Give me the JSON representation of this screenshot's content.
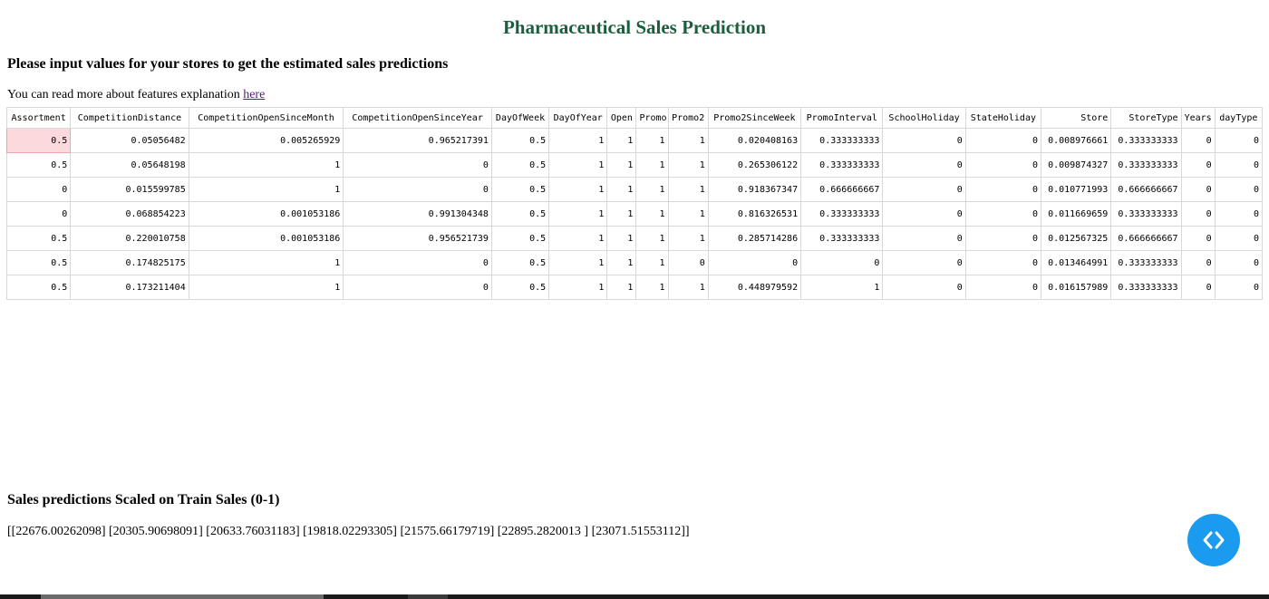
{
  "title": "Pharmaceutical Sales Prediction",
  "subtitle": "Please input values for your stores to get the estimated sales predictions",
  "read_more": {
    "prefix": "You can read more about features explanation ",
    "link": "here"
  },
  "grid": {
    "columns": [
      "Assortment",
      "CompetitionDistance",
      "CompetitionOpenSinceMonth",
      "CompetitionOpenSinceYear",
      "DayOfWeek",
      "DayOfYear",
      "Open",
      "Promo",
      "Promo2",
      "Promo2SinceWeek",
      "PromoInterval",
      "SchoolHoliday",
      "StateHoliday",
      "Store",
      "StoreType",
      "Years",
      "dayType"
    ],
    "rows": [
      [
        "0.5",
        "0.05056482",
        "0.005265929",
        "0.965217391",
        "0.5",
        "1",
        "1",
        "1",
        "1",
        "0.020408163",
        "0.333333333",
        "0",
        "0",
        "0.008976661",
        "0.333333333",
        "0",
        "0"
      ],
      [
        "0.5",
        "0.05648198",
        "1",
        "0",
        "0.5",
        "1",
        "1",
        "1",
        "1",
        "0.265306122",
        "0.333333333",
        "0",
        "0",
        "0.009874327",
        "0.333333333",
        "0",
        "0"
      ],
      [
        "0",
        "0.015599785",
        "1",
        "0",
        "0.5",
        "1",
        "1",
        "1",
        "1",
        "0.918367347",
        "0.666666667",
        "0",
        "0",
        "0.010771993",
        "0.666666667",
        "0",
        "0"
      ],
      [
        "0",
        "0.068854223",
        "0.001053186",
        "0.991304348",
        "0.5",
        "1",
        "1",
        "1",
        "1",
        "0.816326531",
        "0.333333333",
        "0",
        "0",
        "0.011669659",
        "0.333333333",
        "0",
        "0"
      ],
      [
        "0.5",
        "0.220010758",
        "0.001053186",
        "0.956521739",
        "0.5",
        "1",
        "1",
        "1",
        "1",
        "0.285714286",
        "0.333333333",
        "0",
        "0",
        "0.012567325",
        "0.666666667",
        "0",
        "0"
      ],
      [
        "0.5",
        "0.174825175",
        "1",
        "0",
        "0.5",
        "1",
        "1",
        "1",
        "0",
        "0",
        "0",
        "0",
        "0",
        "0.013464991",
        "0.333333333",
        "0",
        "0"
      ],
      [
        "0.5",
        "0.173211404",
        "1",
        "0",
        "0.5",
        "1",
        "1",
        "1",
        "1",
        "0.448979592",
        "1",
        "0",
        "0",
        "0.016157989",
        "0.333333333",
        "0",
        "0"
      ]
    ]
  },
  "predictions": {
    "title": "Sales predictions Scaled on Train Sales (0-1)",
    "values": "[[22676.00262098] [20305.90698091] [20633.76031183] [19818.02293305] [21575.66179719] [22895.2820013 ] [23071.51553112]]"
  },
  "embed_button": {
    "icon": "code-icon",
    "color": "#1a9bf0"
  },
  "colors": {
    "title": "#1b5e3b",
    "active_cell": "#fbd9dc",
    "link": "#551a8b"
  }
}
